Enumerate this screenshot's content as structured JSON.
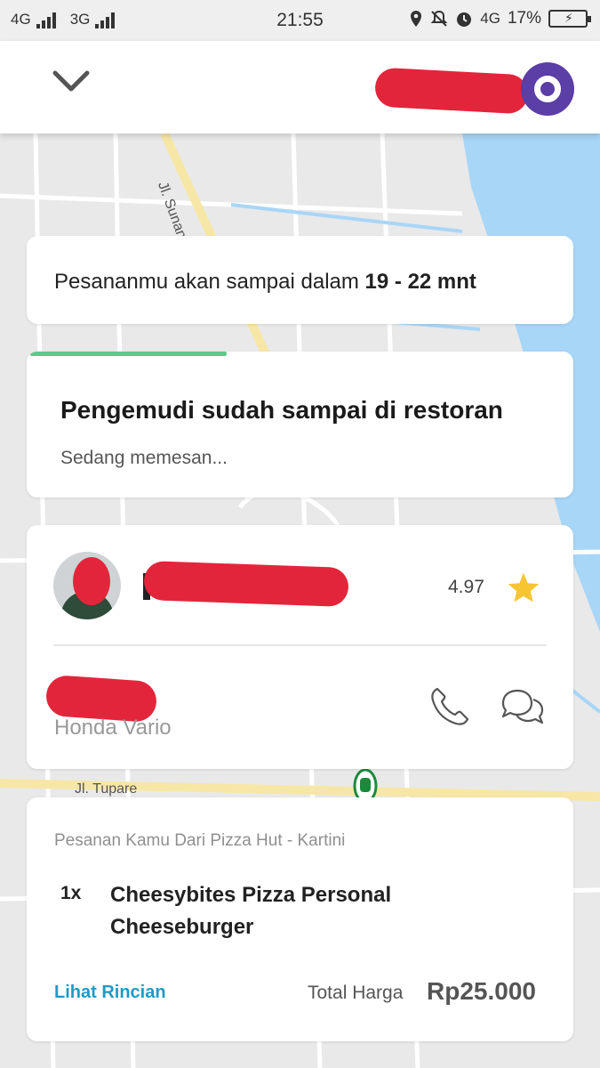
{
  "status_bar": {
    "network_1": "4G",
    "network_2": "3G",
    "time": "21:55",
    "network_3": "4G",
    "battery": "17%"
  },
  "header": {
    "back_icon": "chevron-down-icon",
    "brand_icon": "gojek-logo-icon",
    "brand_color": "#5b3ea6"
  },
  "map": {
    "street_1": "Jl. Sunan G",
    "street_2": "Jl. Tupare"
  },
  "eta": {
    "prefix": "Pesananmu akan sampai dalam ",
    "time_range": "19 - 22 mnt"
  },
  "status": {
    "title": "Pengemudi sudah sampai di restoran",
    "subtitle": "Sedang memesan...",
    "progress": 0.36,
    "progress_color": "#5cc98b"
  },
  "driver": {
    "rating": "4.97",
    "rating_icon": "star-icon",
    "vehicle": "Honda Vario",
    "call_icon": "phone-icon",
    "chat_icon": "chat-icon"
  },
  "order": {
    "from": "Pesanan Kamu Dari Pizza Hut - Kartini",
    "items": [
      {
        "qty": "1x",
        "name": "Cheesybites Pizza Personal Cheeseburger"
      }
    ],
    "detail_link": "Lihat Rincian",
    "total_label": "Total Harga",
    "total_value": "Rp25.000",
    "link_color": "#1d9bc6"
  }
}
